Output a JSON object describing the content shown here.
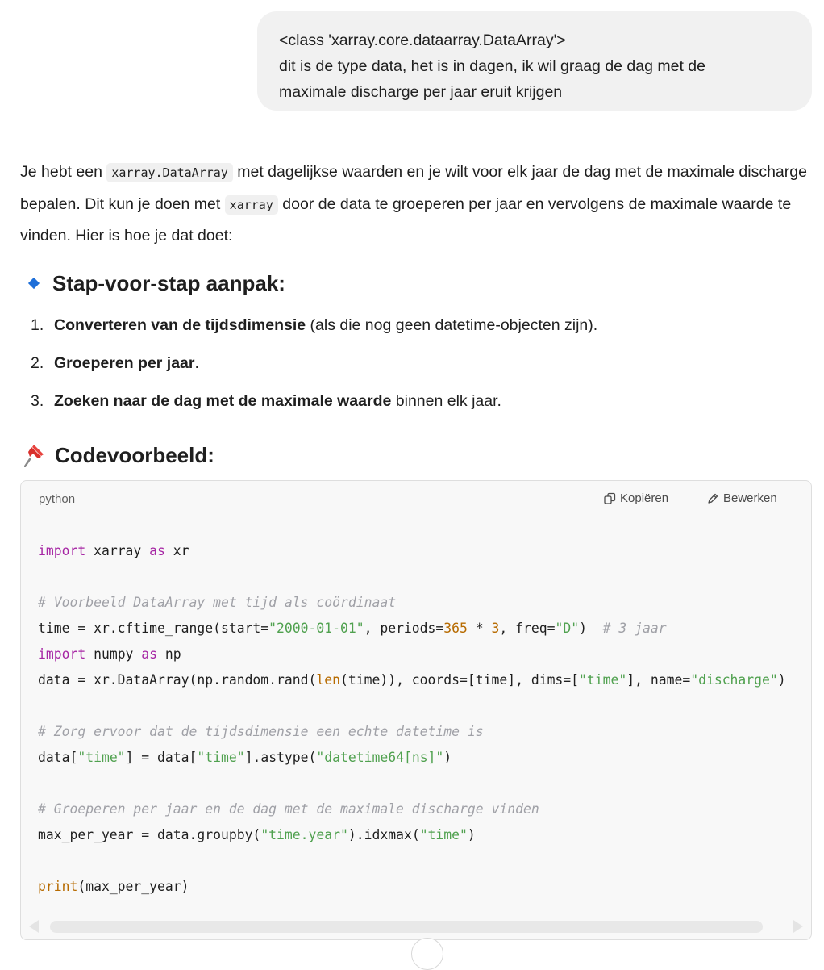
{
  "user_message": {
    "lines": [
      "<class 'xarray.core.dataarray.DataArray'>",
      "dit is de type data, het is in dagen, ik wil graag de dag met de",
      "maximale discharge per jaar eruit krijgen"
    ]
  },
  "response": {
    "intro": {
      "t1": "Je hebt een ",
      "code1": "xarray.DataArray",
      "t2": " met dagelijkse waarden en je wilt voor elk jaar de dag met de maximale discharge bepalen. Dit kun je doen met ",
      "code2": "xarray",
      "t3": " door de data te groeperen per jaar en vervolgens de maximale waarde te vinden. Hier is hoe je dat doet:"
    },
    "steps_heading": "Stap-voor-stap aanpak:",
    "steps": [
      {
        "num": "1.",
        "bold": "Converteren van de tijdsdimensie",
        "rest": " (als die nog geen datetime-objecten zijn)."
      },
      {
        "num": "2.",
        "bold": "Groeperen per jaar",
        "rest": "."
      },
      {
        "num": "3.",
        "bold": "Zoeken naar de dag met de maximale waarde",
        "rest": " binnen elk jaar."
      }
    ],
    "code_heading": "Codevoorbeeld:",
    "code_block": {
      "language": "python",
      "copy_label": "Kopiëren",
      "edit_label": "Bewerken",
      "code": {
        "import": "import",
        "as": "as",
        "xr_mod": " xarray ",
        "xr_alias": " xr",
        "comment1": "# Voorbeeld DataArray met tijd als coördinaat",
        "time_pre": "time = xr.cftime_range(start=",
        "start_val": "\"2000-01-01\"",
        "periods_pre": ", periods=",
        "periods_val": "365",
        "mul": " * ",
        "mul_val": "3",
        "freq_pre": ", freq=",
        "freq_val": "\"D\"",
        "close1": ")  ",
        "comment_3jaar": "# 3 jaar",
        "np_mod": " numpy ",
        "np_alias": " np",
        "data_pre": "data = xr.DataArray(np.random.rand(",
        "len": "len",
        "data_mid": "(time)), coords=[time], dims=[",
        "dims_val": "\"time\"",
        "name_pre": "], name=",
        "name_val": "\"discharge\"",
        "name_post": ")",
        "comment2": "# Zorg ervoor dat de tijdsdimensie een echte datetime is",
        "d1": "data[",
        "time_str": "\"time\"",
        "d2": "] = data[",
        "d3": "].astype(",
        "dtype_val": "\"datetime64[ns]\"",
        "d4": ")",
        "comment3": "# Groeperen per jaar en de dag met de maximale discharge vinden",
        "max_pre": "max_per_year = data.groupby(",
        "year_val": "\"time.year\"",
        "max_mid": ").idxmax(",
        "max_post": ")",
        "print": "print",
        "print_arg": "(max_per_year)"
      }
    }
  }
}
